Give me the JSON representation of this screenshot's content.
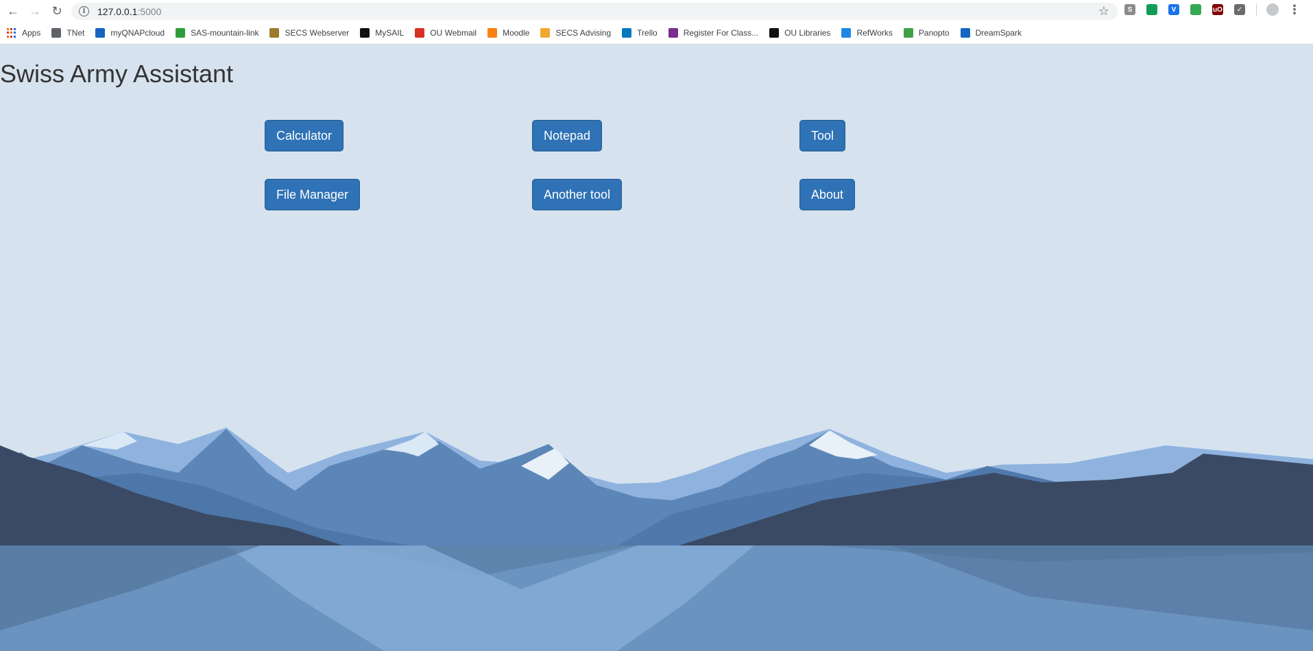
{
  "browser": {
    "url_host": "127.0.0.1",
    "url_port": ":5000",
    "bookmarks": [
      {
        "label": "Apps",
        "icon": "apps-grid-icon"
      },
      {
        "label": "TNet",
        "icon": "folder-icon",
        "color": "#5f6368"
      },
      {
        "label": "myQNAPcloud",
        "icon": "cloud-icon",
        "color": "#1565c0"
      },
      {
        "label": "SAS-mountain-link",
        "icon": "px-icon",
        "color": "#2e9e3a"
      },
      {
        "label": "SECS Webserver",
        "icon": "ou-icon",
        "color": "#9b7a2b"
      },
      {
        "label": "MySAIL",
        "icon": "sail-icon",
        "color": "#111111"
      },
      {
        "label": "OU Webmail",
        "icon": "gmail-icon",
        "color": "#d93025"
      },
      {
        "label": "Moodle",
        "icon": "moodle-icon",
        "color": "#f98012"
      },
      {
        "label": "SECS Advising",
        "icon": "star-burst-icon",
        "color": "#f0a830"
      },
      {
        "label": "Trello",
        "icon": "trello-icon",
        "color": "#0079bf"
      },
      {
        "label": "Register For Class...",
        "icon": "e-icon",
        "color": "#7b2d8e"
      },
      {
        "label": "OU Libraries",
        "icon": "libraries-icon",
        "color": "#111111"
      },
      {
        "label": "RefWorks",
        "icon": "refworks-icon",
        "color": "#1e88e5"
      },
      {
        "label": "Panopto",
        "icon": "panopto-icon",
        "color": "#43a047"
      },
      {
        "label": "DreamSpark",
        "icon": "dreamspark-icon",
        "color": "#1565c0"
      }
    ],
    "extensions": [
      {
        "icon": "s-extension-icon",
        "color": "#8a8a8a",
        "glyph": "S"
      },
      {
        "icon": "green-bubble-extension-icon",
        "color": "#0f9d58",
        "glyph": ""
      },
      {
        "icon": "v-extension-icon",
        "color": "#1a73e8",
        "glyph": "V"
      },
      {
        "icon": "green-square-extension-icon",
        "color": "#34a853",
        "glyph": ""
      },
      {
        "icon": "ublock-extension-icon",
        "color": "#800000",
        "glyph": "uO"
      },
      {
        "icon": "check-extension-icon",
        "color": "#6b6b6b",
        "glyph": "✓"
      }
    ]
  },
  "page": {
    "title": "Swiss Army Assistant",
    "buttons": {
      "calculator": "Calculator",
      "notepad": "Notepad",
      "tool": "Tool",
      "file_manager": "File Manager",
      "another_tool": "Another tool",
      "about": "About"
    }
  },
  "colors": {
    "background": "#d6e3ef",
    "button": "#2f72b5",
    "mountain_dark": "#3a4a64",
    "mountain_mid": "#4f78a8",
    "mountain_light": "#8fb3de",
    "lake": "#5e84ad"
  }
}
